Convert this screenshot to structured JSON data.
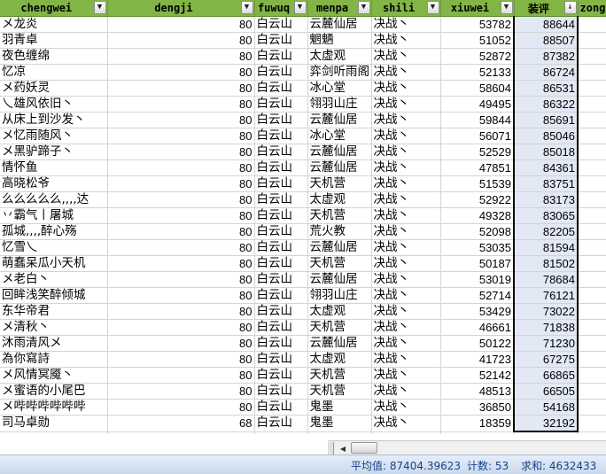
{
  "headers": [
    "chengwei",
    "dengji",
    "fuwuq",
    "menpa",
    "shili",
    "xiuwei",
    "装评",
    "zong"
  ],
  "sort_icon": "sort-desc-filter-icon",
  "filter_icon": "dropdown-arrow-icon",
  "rows": [
    [
      "メ龙炎",
      "80",
      "白云山",
      "云麓仙居",
      "决战丶",
      "53782",
      "88644"
    ],
    [
      "羽青卓",
      "80",
      "白云山",
      "魍魉",
      "决战丶",
      "51052",
      "88507"
    ],
    [
      "夜色缠绵",
      "80",
      "白云山",
      "太虚观",
      "决战丶",
      "52872",
      "87382"
    ],
    [
      "忆凉",
      "80",
      "白云山",
      "弈剑听雨阁",
      "决战丶",
      "52133",
      "86724"
    ],
    [
      "メ药妖灵",
      "80",
      "白云山",
      "冰心堂",
      "决战丶",
      "58604",
      "86531"
    ],
    [
      "乀雄风依旧丶",
      "80",
      "白云山",
      "翎羽山庄",
      "决战丶",
      "49495",
      "86322"
    ],
    [
      "从床上到沙发丶",
      "80",
      "白云山",
      "云麓仙居",
      "决战丶",
      "59844",
      "85691"
    ],
    [
      "メ忆雨随风丶",
      "80",
      "白云山",
      "冰心堂",
      "决战丶",
      "56071",
      "85046"
    ],
    [
      "メ黑驴蹄子丶",
      "80",
      "白云山",
      "云麓仙居",
      "决战丶",
      "52529",
      "85018"
    ],
    [
      "情怀鱼",
      "80",
      "白云山",
      "云麓仙居",
      "决战丶",
      "47851",
      "84361"
    ],
    [
      "高晓松爷",
      "80",
      "白云山",
      "天机营",
      "决战丶",
      "51539",
      "83751"
    ],
    [
      "么么么么么,,,,达",
      "80",
      "白云山",
      "太虚观",
      "决战丶",
      "52922",
      "83173"
    ],
    [
      "丷霸气丨屠城",
      "80",
      "白云山",
      "天机营",
      "决战丶",
      "49328",
      "83065"
    ],
    [
      "孤城,,,,醉心殇",
      "80",
      "白云山",
      "荒火教",
      "决战丶",
      "52098",
      "82205"
    ],
    [
      "忆雪乀",
      "80",
      "白云山",
      "云麓仙居",
      "决战丶",
      "53035",
      "81594"
    ],
    [
      "萌蠢呆瓜小天机",
      "80",
      "白云山",
      "天机营",
      "决战丶",
      "50187",
      "81502"
    ],
    [
      "メ老白丶",
      "80",
      "白云山",
      "云麓仙居",
      "决战丶",
      "53019",
      "78684"
    ],
    [
      "回眸浅笑醉倾城",
      "80",
      "白云山",
      "翎羽山庄",
      "决战丶",
      "52714",
      "76121"
    ],
    [
      "东华帝君",
      "80",
      "白云山",
      "太虚观",
      "决战丶",
      "53429",
      "73022"
    ],
    [
      "メ清秋丶",
      "80",
      "白云山",
      "天机营",
      "决战丶",
      "46661",
      "71838"
    ],
    [
      "沐雨清风メ",
      "80",
      "白云山",
      "云麓仙居",
      "决战丶",
      "50122",
      "71230"
    ],
    [
      "為你寫詩",
      "80",
      "白云山",
      "太虚观",
      "决战丶",
      "41723",
      "67275"
    ],
    [
      "メ风情冥魇丶",
      "80",
      "白云山",
      "天机营",
      "决战丶",
      "52142",
      "66865"
    ],
    [
      "メ蜜语的小尾巴",
      "80",
      "白云山",
      "天机营",
      "决战丶",
      "48513",
      "66505"
    ],
    [
      "メ哔哔哔哔哔哔",
      "80",
      "白云山",
      "鬼墨",
      "决战丶",
      "36850",
      "54168"
    ],
    [
      "司马卓勋",
      "68",
      "白云山",
      "鬼墨",
      "决战丶",
      "18359",
      "32192"
    ]
  ],
  "status": {
    "average": "平均值: 87404.39623",
    "count": "计数: 53",
    "sum": "求和: 4632433"
  },
  "colors": {
    "header_bg": "#82b545",
    "selection_bg": "#e2e8f4",
    "status_bg": "#c9d8ec",
    "status_text": "#15428b"
  }
}
